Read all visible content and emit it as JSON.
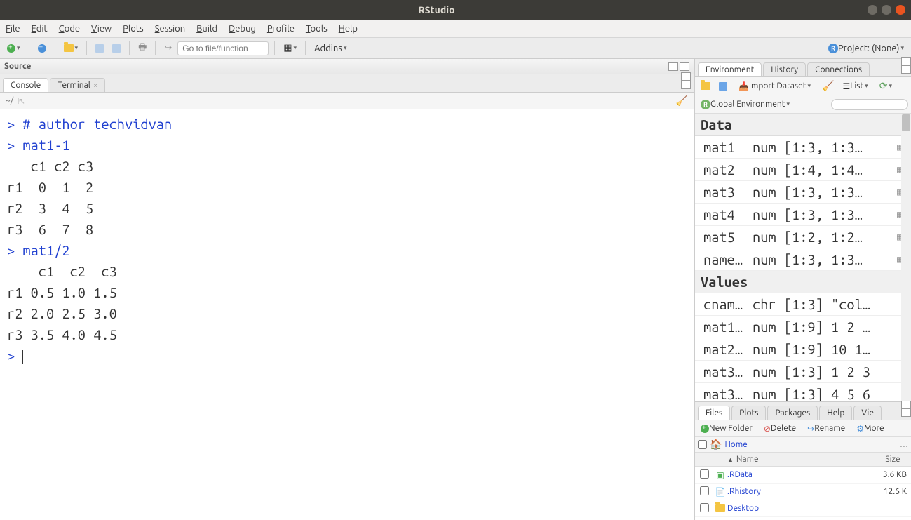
{
  "window": {
    "title": "RStudio"
  },
  "menubar": [
    "File",
    "Edit",
    "Code",
    "View",
    "Plots",
    "Session",
    "Build",
    "Debug",
    "Profile",
    "Tools",
    "Help"
  ],
  "toolbar": {
    "goto_placeholder": "Go to file/function",
    "addins_label": "Addins",
    "project_label": "Project: (None)"
  },
  "source_pane": {
    "title": "Source"
  },
  "console_pane": {
    "tabs": [
      "Console",
      "Terminal"
    ],
    "path": "~/",
    "lines": [
      {
        "t": "prompt",
        "text": "> "
      },
      {
        "t": "code",
        "text": "# author techvidvan"
      },
      {
        "t": "nl"
      },
      {
        "t": "prompt",
        "text": "> "
      },
      {
        "t": "code",
        "text": "mat1-1"
      },
      {
        "t": "nl"
      },
      {
        "t": "out",
        "text": "   c1 c2 c3"
      },
      {
        "t": "nl"
      },
      {
        "t": "out",
        "text": "r1  0  1  2"
      },
      {
        "t": "nl"
      },
      {
        "t": "out",
        "text": "r2  3  4  5"
      },
      {
        "t": "nl"
      },
      {
        "t": "out",
        "text": "r3  6  7  8"
      },
      {
        "t": "nl"
      },
      {
        "t": "prompt",
        "text": "> "
      },
      {
        "t": "code",
        "text": "mat1/2"
      },
      {
        "t": "nl"
      },
      {
        "t": "out",
        "text": "    c1  c2  c3"
      },
      {
        "t": "nl"
      },
      {
        "t": "out",
        "text": "r1 0.5 1.0 1.5"
      },
      {
        "t": "nl"
      },
      {
        "t": "out",
        "text": "r2 2.0 2.5 3.0"
      },
      {
        "t": "nl"
      },
      {
        "t": "out",
        "text": "r3 3.5 4.0 4.5"
      },
      {
        "t": "nl"
      },
      {
        "t": "prompt",
        "text": "> "
      },
      {
        "t": "cursor"
      }
    ]
  },
  "env_pane": {
    "tabs": [
      "Environment",
      "History",
      "Connections"
    ],
    "import_label": "Import Dataset",
    "list_label": "List",
    "scope_label": "Global Environment",
    "sections": [
      {
        "title": "Data",
        "items": [
          {
            "name": "mat1",
            "value": "num [1:3, 1:3…",
            "grid": true
          },
          {
            "name": "mat2",
            "value": "num [1:4, 1:4…",
            "grid": true
          },
          {
            "name": "mat3",
            "value": "num [1:3, 1:3…",
            "grid": true
          },
          {
            "name": "mat4",
            "value": "num [1:3, 1:3…",
            "grid": true
          },
          {
            "name": "mat5",
            "value": "num [1:2, 1:2…",
            "grid": true
          },
          {
            "name": "named…",
            "value": "num [1:3, 1:3…",
            "grid": true
          }
        ]
      },
      {
        "title": "Values",
        "items": [
          {
            "name": "cnames",
            "value": "chr [1:3] \"col…",
            "grid": false
          },
          {
            "name": "mat1.…",
            "value": "num [1:9] 1 2 …",
            "grid": false
          },
          {
            "name": "mat2.…",
            "value": "num [1:9] 10 1…",
            "grid": false
          },
          {
            "name": "mat3.…",
            "value": "num [1:3] 1 2 3",
            "grid": false
          },
          {
            "name": "mat3.…",
            "value": "num [1:3] 4 5 6",
            "grid": false
          }
        ]
      }
    ]
  },
  "files_pane": {
    "tabs": [
      "Files",
      "Plots",
      "Packages",
      "Help",
      "Vie"
    ],
    "toolbar": {
      "new_folder": "New Folder",
      "delete": "Delete",
      "rename": "Rename",
      "more": "More"
    },
    "path_label": "Home",
    "columns": {
      "name": "Name",
      "size": "Size"
    },
    "files": [
      {
        "icon": "rdata",
        "name": ".RData",
        "size": "3.6 KB"
      },
      {
        "icon": "file",
        "name": ".Rhistory",
        "size": "12.6 K"
      },
      {
        "icon": "folder",
        "name": "Desktop",
        "size": ""
      }
    ]
  }
}
